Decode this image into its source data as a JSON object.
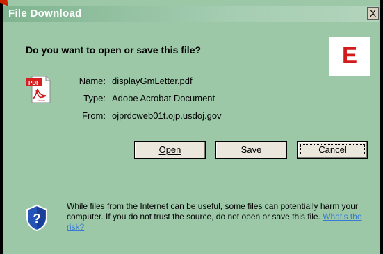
{
  "window": {
    "title": "File Download",
    "close_glyph": "X"
  },
  "dialog": {
    "question": "Do you want to open or save this file?",
    "overlay_letter": "E",
    "file_icon": "pdf-file-icon",
    "fields": [
      {
        "label": "Name:",
        "value": "displayGmLetter.pdf"
      },
      {
        "label": "Type:",
        "value": "Adobe Acrobat Document"
      },
      {
        "label": "From:",
        "value": "ojprdcweb01t.ojp.usdoj.gov"
      }
    ],
    "buttons": {
      "open": "Open",
      "save": "Save",
      "cancel": "Cancel"
    },
    "warning": {
      "icon": "shield-question-icon",
      "text": "While files from the Internet can be useful, some files can potentially harm your computer. If you do not trust the source, do not open or save this file.",
      "link": "What's the risk?"
    }
  },
  "colors": {
    "dialog_bg": "#9cc8a8",
    "overlay_letter": "#d31a1a",
    "link": "#3a7bd5"
  }
}
